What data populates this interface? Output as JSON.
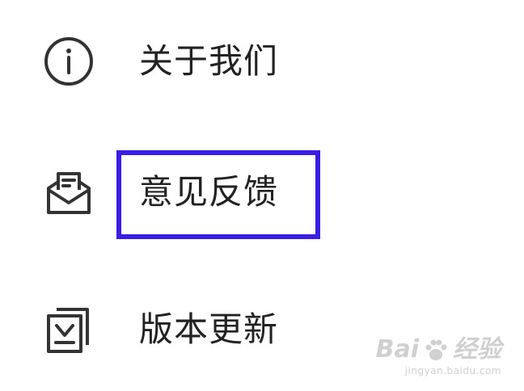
{
  "menu": {
    "items": [
      {
        "label": "关于我们",
        "icon": "info-circle-icon"
      },
      {
        "label": "意见反馈",
        "icon": "envelope-feedback-icon",
        "highlighted": true
      },
      {
        "label": "版本更新",
        "icon": "download-update-icon"
      }
    ]
  },
  "highlight": {
    "color": "#3a1ee6"
  },
  "watermark": {
    "brand": "Bai",
    "brand_suffix": "经验",
    "url": "jingyan.baidu.com"
  }
}
